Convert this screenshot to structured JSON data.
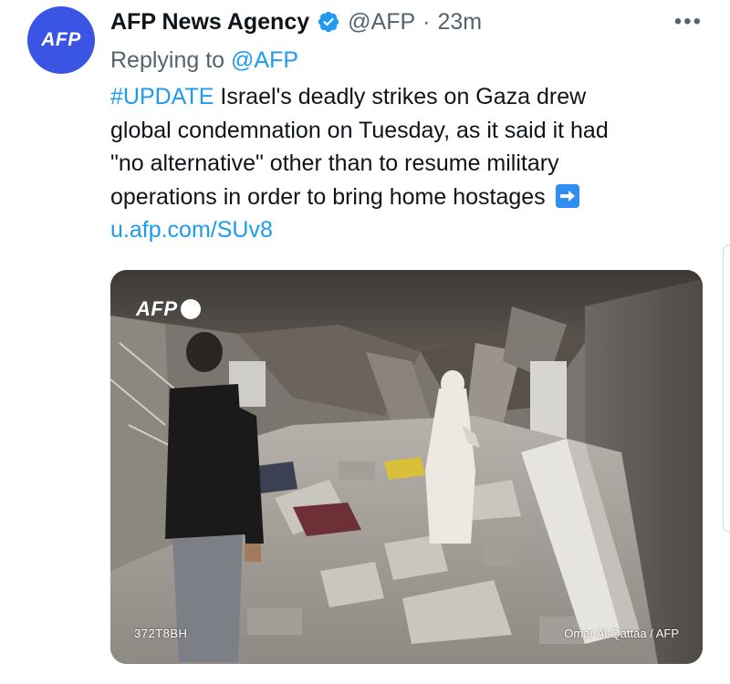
{
  "tweet": {
    "author": {
      "avatar_text": "AFP",
      "display_name": "AFP News Agency",
      "verified_icon": "verified-badge-icon",
      "handle": "@AFP",
      "separator": "·",
      "timestamp": "23m"
    },
    "more_label": "•••",
    "reply": {
      "prefix": "Replying to",
      "mention": "@AFP"
    },
    "body": {
      "hashtag": "#UPDATE",
      "line1_rest": " Israel's deadly strikes on Gaza drew",
      "line2": "global condemnation on Tuesday, as it said it had",
      "line3": "\"no alternative\" other than to resume military",
      "line4": "operations in order to bring home hostages",
      "arrow_icon": "right-arrow-emoji-icon",
      "link": "u.afp.com/SUv8"
    },
    "media": {
      "watermark": "AFP",
      "photo_id": "372T8BH",
      "credit": "Omar Al-Qattaa / AFP"
    }
  },
  "colors": {
    "accent": "#1d9bf0",
    "avatar_bg": "#3a55e3",
    "secondary_text": "#536471",
    "primary_text": "#0f1419"
  }
}
